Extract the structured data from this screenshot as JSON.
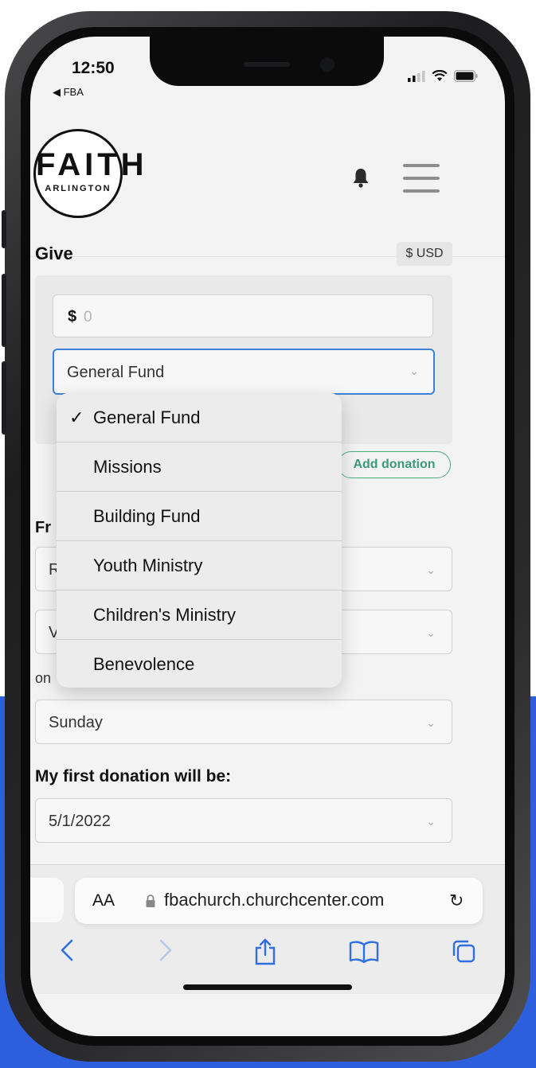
{
  "status_bar": {
    "time": "12:50",
    "back_app": "◀ FBA"
  },
  "logo": {
    "line1": "FAITH",
    "line2": "ARLINGTON"
  },
  "give": {
    "title": "Give",
    "currency": "$ USD",
    "amount_symbol": "$",
    "amount_placeholder": "0",
    "selected_fund": "General Fund",
    "add_donation_label": "Add donation"
  },
  "fund_dropdown": {
    "check": "✓",
    "options": [
      "General Fund",
      "Missions",
      "Building Fund",
      "Youth Ministry",
      "Children's Ministry",
      "Benevolence"
    ]
  },
  "frequency": {
    "label_partial": "Fr",
    "field1_partial": "R",
    "field2_partial": "V",
    "on_label": "on",
    "day_value": "Sunday"
  },
  "first_donation": {
    "label": "My first donation will be:",
    "date": "5/1/2022"
  },
  "browser": {
    "text_size": "AA",
    "url": "fbachurch.churchcenter.com",
    "reload": "↻"
  },
  "colors": {
    "accent_blue": "#3b82d6",
    "add_green": "#3a9a7a",
    "backdrop_blue": "#2d5fdc"
  }
}
